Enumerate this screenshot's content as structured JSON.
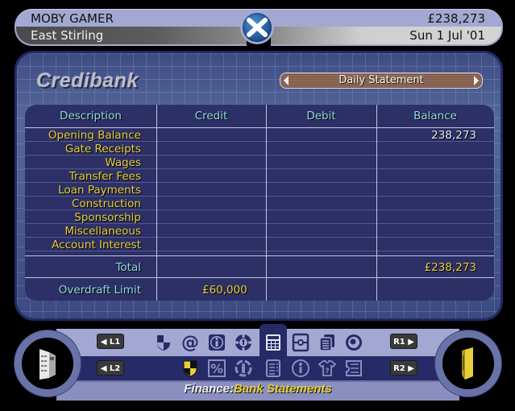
{
  "header": {
    "manager_name": "MOBY GAMER",
    "club_name": "East Stirling",
    "balance": "£238,273",
    "date": "Sun 1 Jul '01",
    "emblem_icon": "scotland-flag-icon"
  },
  "panel": {
    "title": "Credibank",
    "statement_selector": {
      "value": "Daily Statement",
      "prev_icon": "arrow-left-icon",
      "next_icon": "arrow-right-icon"
    },
    "table": {
      "columns": [
        "Description",
        "Credit",
        "Debit",
        "Balance"
      ],
      "rows": [
        {
          "description": "Opening Balance",
          "credit": "",
          "debit": "",
          "balance": "238,273"
        },
        {
          "description": "Gate Receipts",
          "credit": "",
          "debit": "",
          "balance": ""
        },
        {
          "description": "Wages",
          "credit": "",
          "debit": "",
          "balance": ""
        },
        {
          "description": "Transfer Fees",
          "credit": "",
          "debit": "",
          "balance": ""
        },
        {
          "description": "Loan Payments",
          "credit": "",
          "debit": "",
          "balance": ""
        },
        {
          "description": "Construction",
          "credit": "",
          "debit": "",
          "balance": ""
        },
        {
          "description": "Sponsorship",
          "credit": "",
          "debit": "",
          "balance": ""
        },
        {
          "description": "Miscellaneous",
          "credit": "",
          "debit": "",
          "balance": ""
        },
        {
          "description": "Account Interest",
          "credit": "",
          "debit": "",
          "balance": ""
        }
      ],
      "total": {
        "label": "Total",
        "balance": "£238,273"
      },
      "overdraft": {
        "label": "Overdraft Limit",
        "credit": "£60,000"
      }
    }
  },
  "bottom_bar": {
    "l1": "L1",
    "l2": "L2",
    "r1": "R1",
    "r2": "R2",
    "left_ring_icon": "office-building-icon",
    "right_ring_icon": "gold-shield-icon",
    "top_icons": [
      "club-shield-icon",
      "email-icon",
      "info-icon",
      "lifebuoy-icon",
      "calculator-icon",
      "safe-icon",
      "documents-icon",
      "football-icon"
    ],
    "bottom_icons": [
      "finance-shield-icon",
      "percent-icon",
      "staff-icon",
      "list-icon",
      "person-circle-icon",
      "shirt-question-icon",
      "ticket-icon"
    ],
    "active_top_index": 4,
    "active_bottom_index": 0,
    "breadcrumb_section": "Finance:",
    "breadcrumb_page": "Bank Statements"
  },
  "colors": {
    "accent_yellow": "#e6cf3a",
    "header_cyan": "#8fdde0",
    "panel_navy": "#2d3066",
    "bar_lavender": "#a3a8d2"
  }
}
